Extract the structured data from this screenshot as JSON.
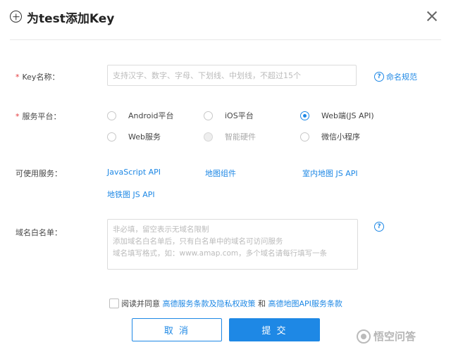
{
  "header": {
    "title": "为test添加Key"
  },
  "key_name": {
    "required_mark": "*",
    "label": "Key名称：",
    "placeholder": "支持汉字、数字、字母、下划线、中划线，不超过15个",
    "help_label": "命名规范"
  },
  "platform": {
    "required_mark": "*",
    "label": "服务平台：",
    "options": [
      {
        "label": "Android平台",
        "checked": false,
        "disabled": false
      },
      {
        "label": "iOS平台",
        "checked": false,
        "disabled": false
      },
      {
        "label": "Web端(JS API)",
        "checked": true,
        "disabled": false
      },
      {
        "label": "Web服务",
        "checked": false,
        "disabled": false
      },
      {
        "label": "智能硬件",
        "checked": false,
        "disabled": true
      },
      {
        "label": "微信小程序",
        "checked": false,
        "disabled": false
      }
    ]
  },
  "services": {
    "label": "可使用服务：",
    "items": [
      "JavaScript API",
      "地图组件",
      "室内地图 JS API",
      "地铁图 JS API"
    ]
  },
  "whitelist": {
    "label": "域名白名单：",
    "placeholder": "非必填，留空表示无域名限制\n添加域名白名单后，只有白名单中的域名可访问服务\n域名填写格式，如：www.amap.com，多个域名请每行填写一条"
  },
  "agreement": {
    "prefix": "阅读并同意",
    "link1": "高德服务条款及隐私权政策",
    "conjunction": "和",
    "link2": "高德地图API服务条款"
  },
  "buttons": {
    "cancel": "取 消",
    "submit": "提 交"
  },
  "watermark": {
    "text": "悟空问答"
  },
  "colors": {
    "accent": "#1e88e5",
    "required": "#e4393c"
  }
}
